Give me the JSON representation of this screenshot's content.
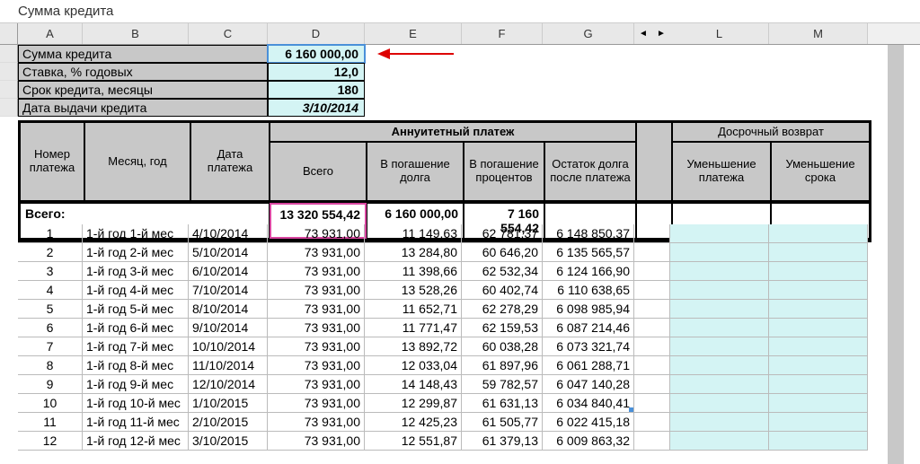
{
  "formula_bar": "Сумма кредита",
  "columns": [
    "A",
    "B",
    "C",
    "D",
    "E",
    "F",
    "G",
    "L",
    "M"
  ],
  "gap_arrows": {
    "left": "◄",
    "right": "►"
  },
  "params": [
    {
      "label": "Сумма кредита",
      "value": "6 160 000,00"
    },
    {
      "label": "Ставка, % годовых",
      "value": "12,0"
    },
    {
      "label": "Срок кредита, месяцы",
      "value": "180"
    },
    {
      "label": "Дата выдачи кредита",
      "value": "3/10/2014"
    }
  ],
  "headers": {
    "num": "Номер платежа",
    "month": "Месяц, год",
    "date": "Дата платежа",
    "annuity": "Аннуитетный платеж",
    "total": "Всего",
    "debt": "В погашение долга",
    "interest": "В погашение процентов",
    "remain": "Остаток долга после платежа",
    "early": "Досрочный возврат",
    "dec_pay": "Уменьшение платежа",
    "dec_term": "Уменьшение срока"
  },
  "totals": {
    "label": "Всего:",
    "total": "13 320 554,42",
    "debt": "6 160 000,00",
    "interest": "7 160 554,42"
  },
  "rows": [
    {
      "n": "1",
      "m": "1-й год 1-й мес",
      "d": "4/10/2014",
      "t": "73 931,00",
      "db": "11 149,63",
      "i": "62 781,37",
      "r": "6 148 850,37"
    },
    {
      "n": "2",
      "m": "1-й год 2-й мес",
      "d": "5/10/2014",
      "t": "73 931,00",
      "db": "13 284,80",
      "i": "60 646,20",
      "r": "6 135 565,57"
    },
    {
      "n": "3",
      "m": "1-й год 3-й мес",
      "d": "6/10/2014",
      "t": "73 931,00",
      "db": "11 398,66",
      "i": "62 532,34",
      "r": "6 124 166,90"
    },
    {
      "n": "4",
      "m": "1-й год 4-й мес",
      "d": "7/10/2014",
      "t": "73 931,00",
      "db": "13 528,26",
      "i": "60 402,74",
      "r": "6 110 638,65"
    },
    {
      "n": "5",
      "m": "1-й год 5-й мес",
      "d": "8/10/2014",
      "t": "73 931,00",
      "db": "11 652,71",
      "i": "62 278,29",
      "r": "6 098 985,94"
    },
    {
      "n": "6",
      "m": "1-й год 6-й мес",
      "d": "9/10/2014",
      "t": "73 931,00",
      "db": "11 771,47",
      "i": "62 159,53",
      "r": "6 087 214,46"
    },
    {
      "n": "7",
      "m": "1-й год 7-й мес",
      "d": "10/10/2014",
      "t": "73 931,00",
      "db": "13 892,72",
      "i": "60 038,28",
      "r": "6 073 321,74"
    },
    {
      "n": "8",
      "m": "1-й год 8-й мес",
      "d": "11/10/2014",
      "t": "73 931,00",
      "db": "12 033,04",
      "i": "61 897,96",
      "r": "6 061 288,71"
    },
    {
      "n": "9",
      "m": "1-й год 9-й мес",
      "d": "12/10/2014",
      "t": "73 931,00",
      "db": "14 148,43",
      "i": "59 782,57",
      "r": "6 047 140,28"
    },
    {
      "n": "10",
      "m": "1-й год 10-й мес",
      "d": "1/10/2015",
      "t": "73 931,00",
      "db": "12 299,87",
      "i": "61 631,13",
      "r": "6 034 840,41"
    },
    {
      "n": "11",
      "m": "1-й год 11-й мес",
      "d": "2/10/2015",
      "t": "73 931,00",
      "db": "12 425,23",
      "i": "61 505,77",
      "r": "6 022 415,18"
    },
    {
      "n": "12",
      "m": "1-й год 12-й мес",
      "d": "3/10/2015",
      "t": "73 931,00",
      "db": "12 551,87",
      "i": "61 379,13",
      "r": "6 009 863,32"
    }
  ],
  "colors": {
    "accent": "#d946a0",
    "selection": "#4a90d9",
    "cyan": "#d4f4f4"
  }
}
